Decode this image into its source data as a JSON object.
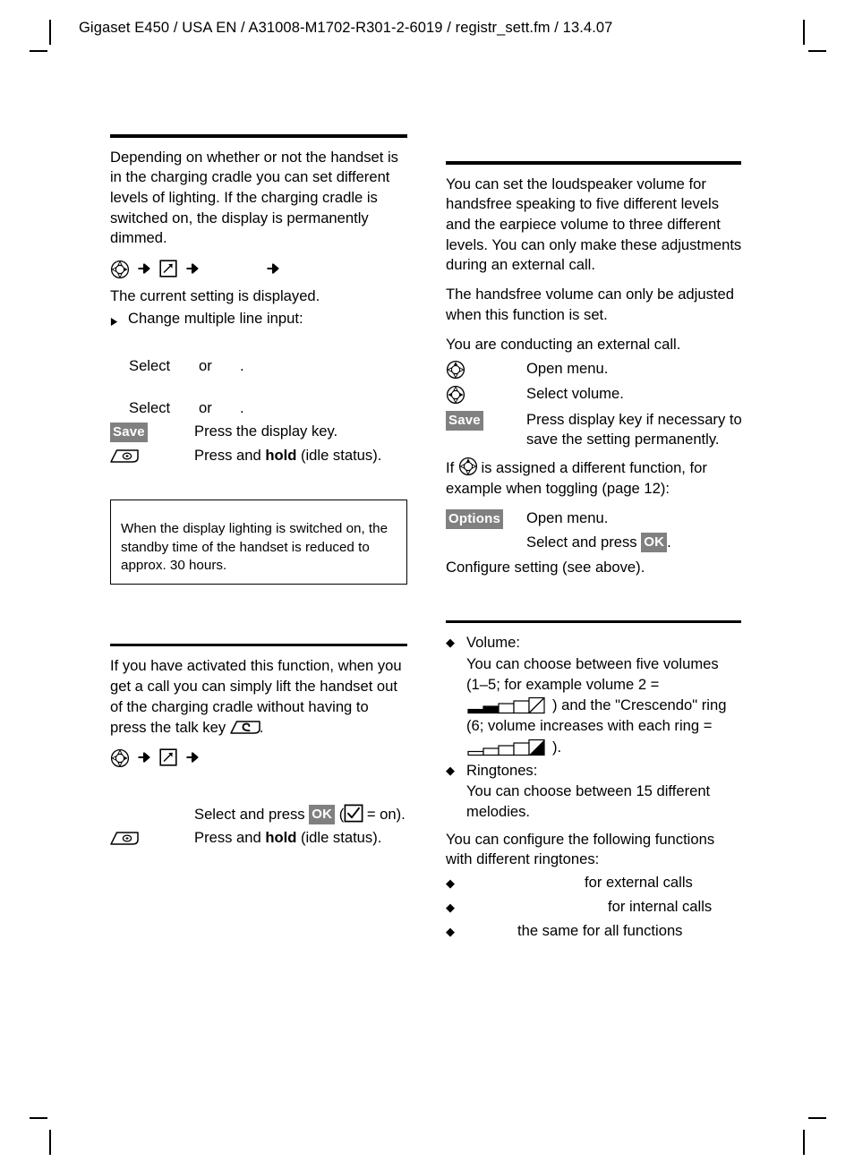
{
  "page": {
    "header": "Gigaset E450 / USA EN / A31008-M1702-R301-2-6019 / registr_sett.fm / 13.4.07"
  },
  "left_column": {
    "display_lighting": {
      "intro": "Depending on whether or not the handset is in the charging cradle you can set different levels of lighting. If the charging cradle is switched on, the display is permanently dimmed.",
      "menu_path": {
        "nav_icon": "nav-key-icon",
        "arrow1": "arrow-right-icon",
        "settings_icon": "settings-key-icon",
        "arrow2": "arrow-right-icon",
        "arrow3": "arrow-right-icon"
      },
      "current_setting": "The current setting is displayed.",
      "change_item": "Change multiple line input:",
      "select_rows": [
        {
          "lead": "Select",
          "mid": "or",
          "end": "."
        },
        {
          "lead": "Select",
          "mid": "or",
          "end": "."
        }
      ],
      "steps": [
        {
          "key": "Save",
          "key_type": "display-key",
          "text": "Press the display key."
        },
        {
          "key": "end-call-key-icon",
          "key_type": "icon",
          "text_before": "Press and ",
          "text_bold": "hold",
          "text_after": " (idle status)."
        }
      ],
      "note": "When the display lighting is switched on, the standby time of the handset is reduced to approx. 30 hours."
    },
    "auto_answer": {
      "intro_before": "If you have activated this function, when you get a call you can simply lift the handset out of the charging cradle without having to press the talk key ",
      "talk_key_icon": "talk-key-icon",
      "intro_after": ".",
      "menu_path": {
        "nav_icon": "nav-key-icon",
        "arrow1": "arrow-right-icon",
        "settings_icon": "settings-key-icon",
        "arrow2": "arrow-right-icon"
      },
      "steps": [
        {
          "key": "",
          "key_type": "none",
          "text_before": "Select and press ",
          "badge": "OK",
          "text_mid": " (",
          "checkbox": "checkbox-checked-icon",
          "text_after": " = on)."
        },
        {
          "key": "end-call-key-icon",
          "key_type": "icon",
          "text_before": "Press and ",
          "text_bold": "hold",
          "text_after": " (idle status)."
        }
      ]
    }
  },
  "right_column": {
    "volume": {
      "intro": "You can set the loudspeaker volume for handsfree speaking to five different levels and the earpiece volume to three different levels. You can only make these adjustments during an external call.",
      "handsfree_note": "The handsfree volume can only be adjusted when this function is set.",
      "precondition": "You are conducting an external call.",
      "steps": [
        {
          "key": "nav-key-up-icon",
          "key_type": "icon",
          "text": "Open menu."
        },
        {
          "key": "nav-key-lr-icon",
          "key_type": "icon",
          "text": "Select volume."
        },
        {
          "key": "Save",
          "key_type": "display-key",
          "text": "Press display key if necessary to save the setting permanently."
        }
      ],
      "assigned_note_before": "If ",
      "assigned_note_icon": "nav-key-up-icon",
      "assigned_note_after": " is assigned a different function, for example when toggling (page 12):",
      "options_steps": [
        {
          "key": "Options",
          "key_type": "display-key",
          "text": "Open menu."
        },
        {
          "key": "",
          "key_type": "none",
          "text_before": "Select and press ",
          "badge": "OK",
          "text_after": "."
        }
      ],
      "configure": "Configure setting (see above)."
    },
    "ringtones": {
      "bullets": [
        {
          "title": "Volume:",
          "line1": "You can choose between five volumes",
          "line2": "(1–5; for example volume 2 =",
          "bar1": "volume-level-2-icon",
          "line3": ") and the \"Crescendo\" ring",
          "line4": "(6; volume increases with each ring =",
          "bar2": "crescendo-icon",
          "line5": ")."
        },
        {
          "title": "Ringtones:",
          "line1": "You can choose between 15 different",
          "line2": "melodies."
        }
      ],
      "configure_intro": "You can configure the following functions with different ringtones:",
      "term_items": [
        {
          "gap": 132,
          "text": "for external calls"
        },
        {
          "gap": 158,
          "text": "for internal calls"
        },
        {
          "gap": 57,
          "text": "the same for all functions"
        }
      ]
    }
  },
  "colors": {
    "display_key_bg": "#808080",
    "display_key_fg": "#ffffff",
    "rule": "#000000",
    "text": "#000000"
  }
}
